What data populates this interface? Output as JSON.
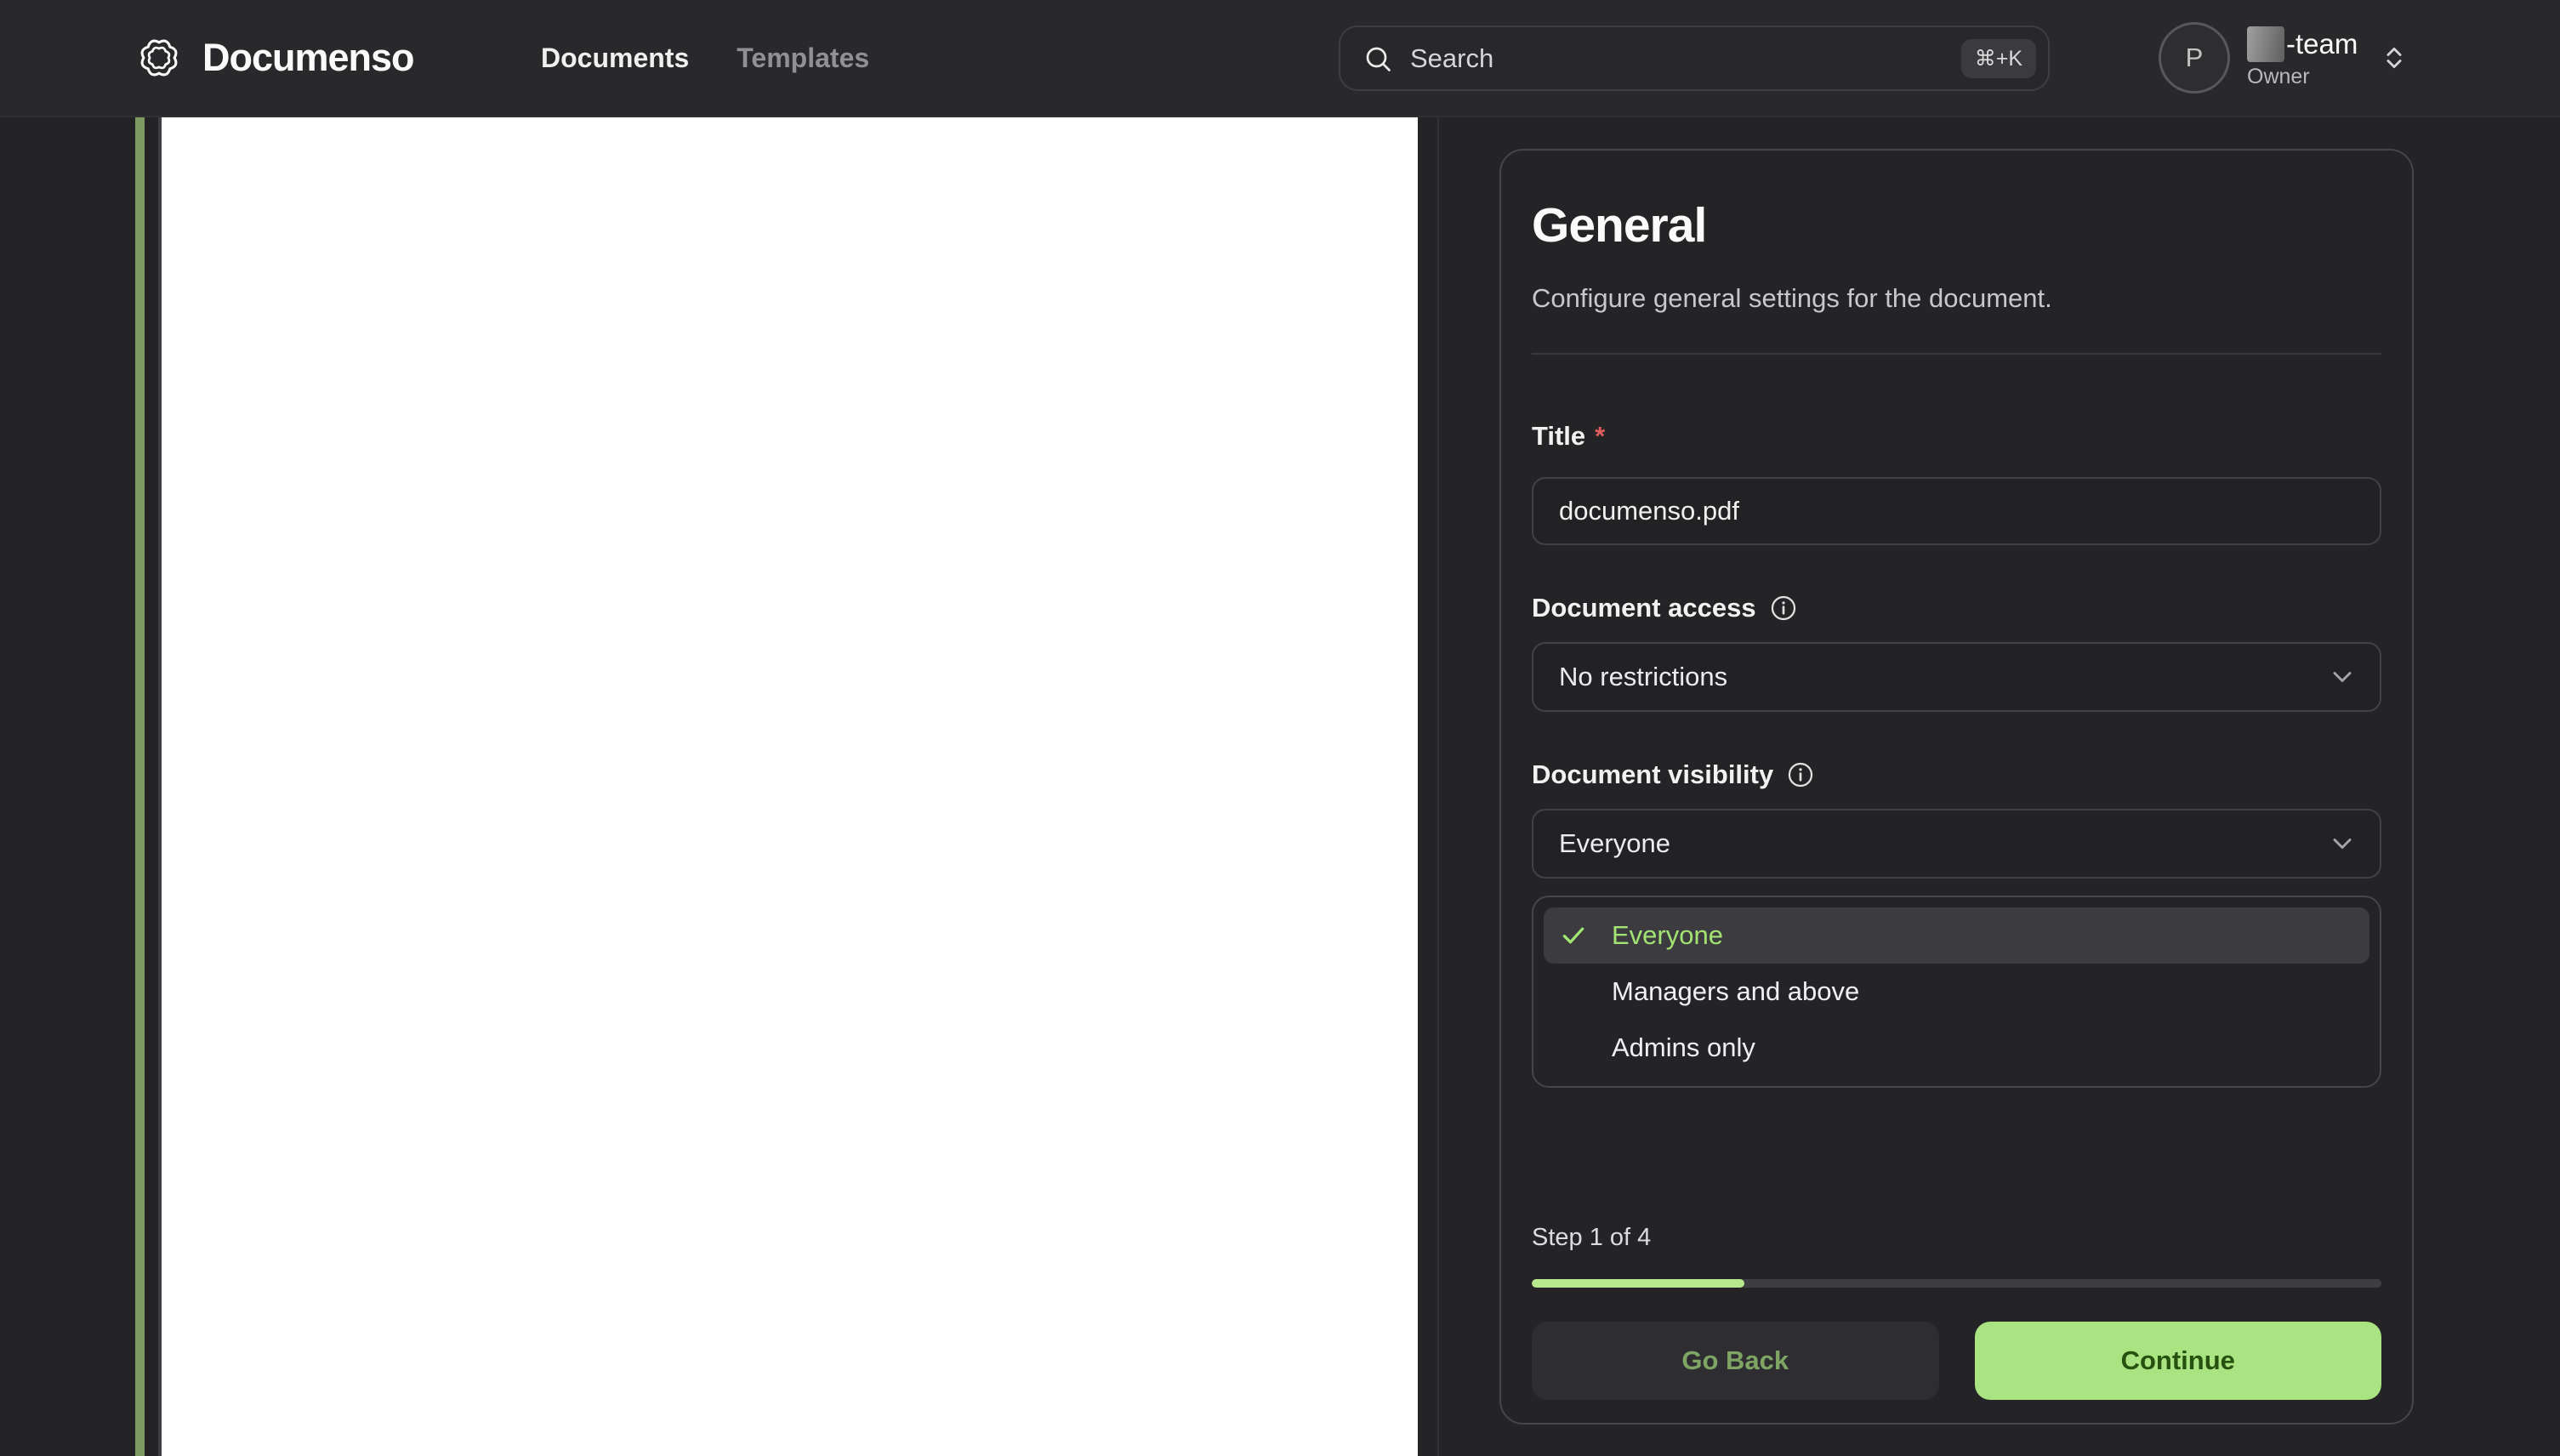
{
  "navbar": {
    "brand": "Documenso",
    "nav_items": [
      {
        "label": "Documents",
        "active": true
      },
      {
        "label": "Templates",
        "active": false
      }
    ],
    "search": {
      "placeholder": "Search",
      "shortcut": "⌘+K"
    },
    "account": {
      "avatar_initial": "P",
      "team_suffix": "-team",
      "role": "Owner"
    }
  },
  "panel": {
    "title": "General",
    "subtitle": "Configure general settings for the document.",
    "fields": {
      "title": {
        "label": "Title",
        "required_marker": "*",
        "value": "documenso.pdf"
      },
      "document_access": {
        "label": "Document access",
        "value": "No restrictions"
      },
      "document_visibility": {
        "label": "Document visibility",
        "value": "Everyone"
      }
    },
    "visibility_menu": {
      "options": [
        {
          "label": "Everyone",
          "selected": true
        },
        {
          "label": "Managers and above",
          "selected": false
        },
        {
          "label": "Admins only",
          "selected": false
        }
      ]
    },
    "stepper": {
      "label": "Step 1 of 4",
      "progress_percent": 25
    },
    "buttons": {
      "back": "Go Back",
      "back_disabled": true,
      "continue": "Continue"
    }
  },
  "colors": {
    "accent_green": "#a2e771",
    "progress_fill": "#b7e88e",
    "continue_button_bg": "#aae381",
    "continue_button_text": "#26510f",
    "go_back_text": "#7ea563",
    "page_edge_green": "#7e9b63",
    "chrome_background": "#242427"
  }
}
